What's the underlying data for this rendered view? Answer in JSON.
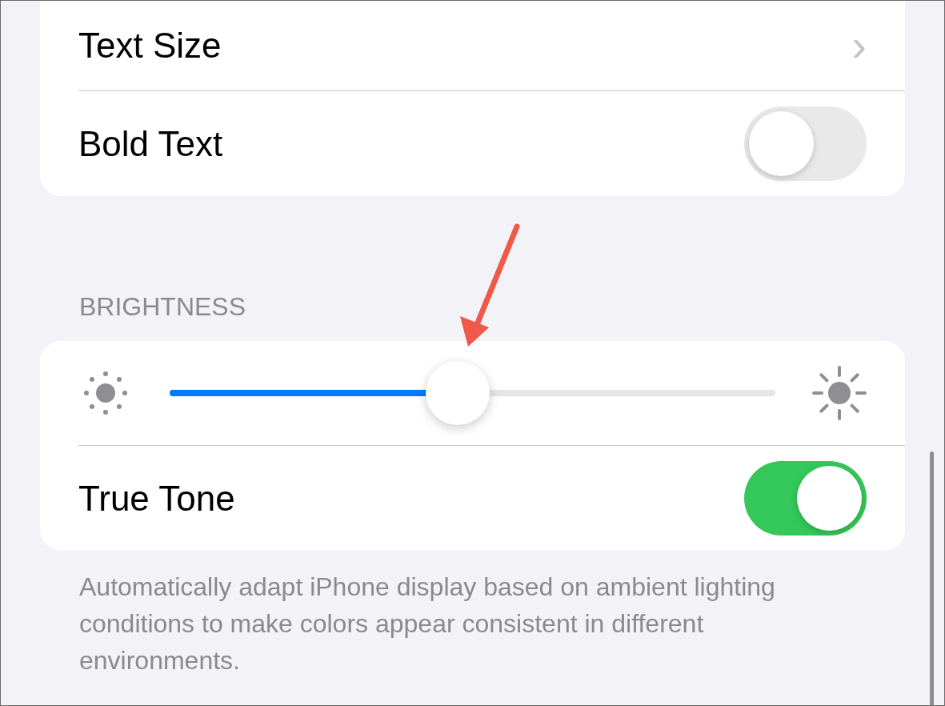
{
  "display_group": {
    "rows": [
      {
        "kind": "link",
        "label": "Text Size",
        "chevron": "›"
      },
      {
        "kind": "toggle",
        "label": "Bold Text",
        "on": false
      }
    ]
  },
  "brightness": {
    "header": "BRIGHTNESS",
    "slider": {
      "level": 0.476
    },
    "rows": [
      {
        "kind": "toggle",
        "label": "True Tone",
        "on": true
      }
    ],
    "footer": "Automatically adapt iPhone display based on ambient lighting conditions to make colors appear consistent in different environments."
  }
}
